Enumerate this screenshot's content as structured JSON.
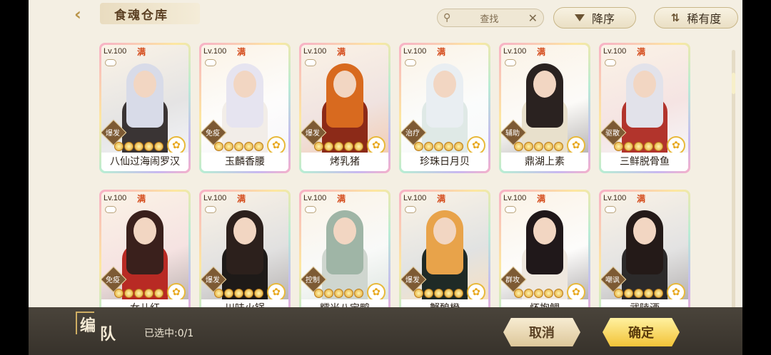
{
  "header": {
    "title": "食魂仓库",
    "back_icon": "back-arrow-icon"
  },
  "search": {
    "placeholder": "查找"
  },
  "sort": {
    "label": "降序"
  },
  "filter": {
    "label": "稀有度"
  },
  "cards": [
    {
      "level": "Lv.100",
      "max": "满",
      "role": "爆发",
      "name": "八仙过海闹罗汉",
      "hair": "#d8dbe8",
      "body": "#3a3434"
    },
    {
      "level": "Lv.100",
      "max": "满",
      "role": "免疫",
      "name": "玉麟香腰",
      "hair": "#e6e4f0",
      "body": "#f2ede8"
    },
    {
      "level": "Lv.100",
      "max": "满",
      "role": "爆发",
      "name": "烤乳猪",
      "hair": "#d86a1f",
      "body": "#8c2a18"
    },
    {
      "level": "Lv.100",
      "max": "满",
      "role": "治疗",
      "name": "珍珠日月贝",
      "hair": "#e9eef2",
      "body": "#dfe9e6"
    },
    {
      "level": "Lv.100",
      "max": "满",
      "role": "辅助",
      "name": "鼎湖上素",
      "hair": "#2a2220",
      "body": "#e8e0cc"
    },
    {
      "level": "Lv.100",
      "max": "满",
      "role": "驱散",
      "name": "三鲜脱骨鱼",
      "hair": "#e2e2ea",
      "body": "#b2342c"
    },
    {
      "level": "Lv.100",
      "max": "满",
      "role": "免疫",
      "name": "女儿红",
      "hair": "#3a201c",
      "body": "#b82a24"
    },
    {
      "level": "Lv.100",
      "max": "满",
      "role": "爆发",
      "name": "川味火锅",
      "hair": "#2c201c",
      "body": "#1e1a18"
    },
    {
      "level": "Lv.100",
      "max": "满",
      "role": "控制",
      "name": "糯米八宝鸭",
      "hair": "#9fb5a6",
      "body": "#cfd6cf"
    },
    {
      "level": "Lv.100",
      "max": "满",
      "role": "爆发",
      "name": "蟹酿橙",
      "hair": "#e8a34a",
      "body": "#1f2a26"
    },
    {
      "level": "Lv.100",
      "max": "满",
      "role": "群攻",
      "name": "怀抱鲤",
      "hair": "#20181a",
      "body": "#efe8df"
    },
    {
      "level": "Lv.100",
      "max": "满",
      "role": "嘲讽",
      "name": "武陵酒",
      "hair": "#241a18",
      "body": "#2c2a2a"
    }
  ],
  "bottom": {
    "team_label_1": "编",
    "team_label_2": "队",
    "selected_text": "已选中:0/1",
    "cancel_label": "取消",
    "confirm_label": "确定"
  }
}
